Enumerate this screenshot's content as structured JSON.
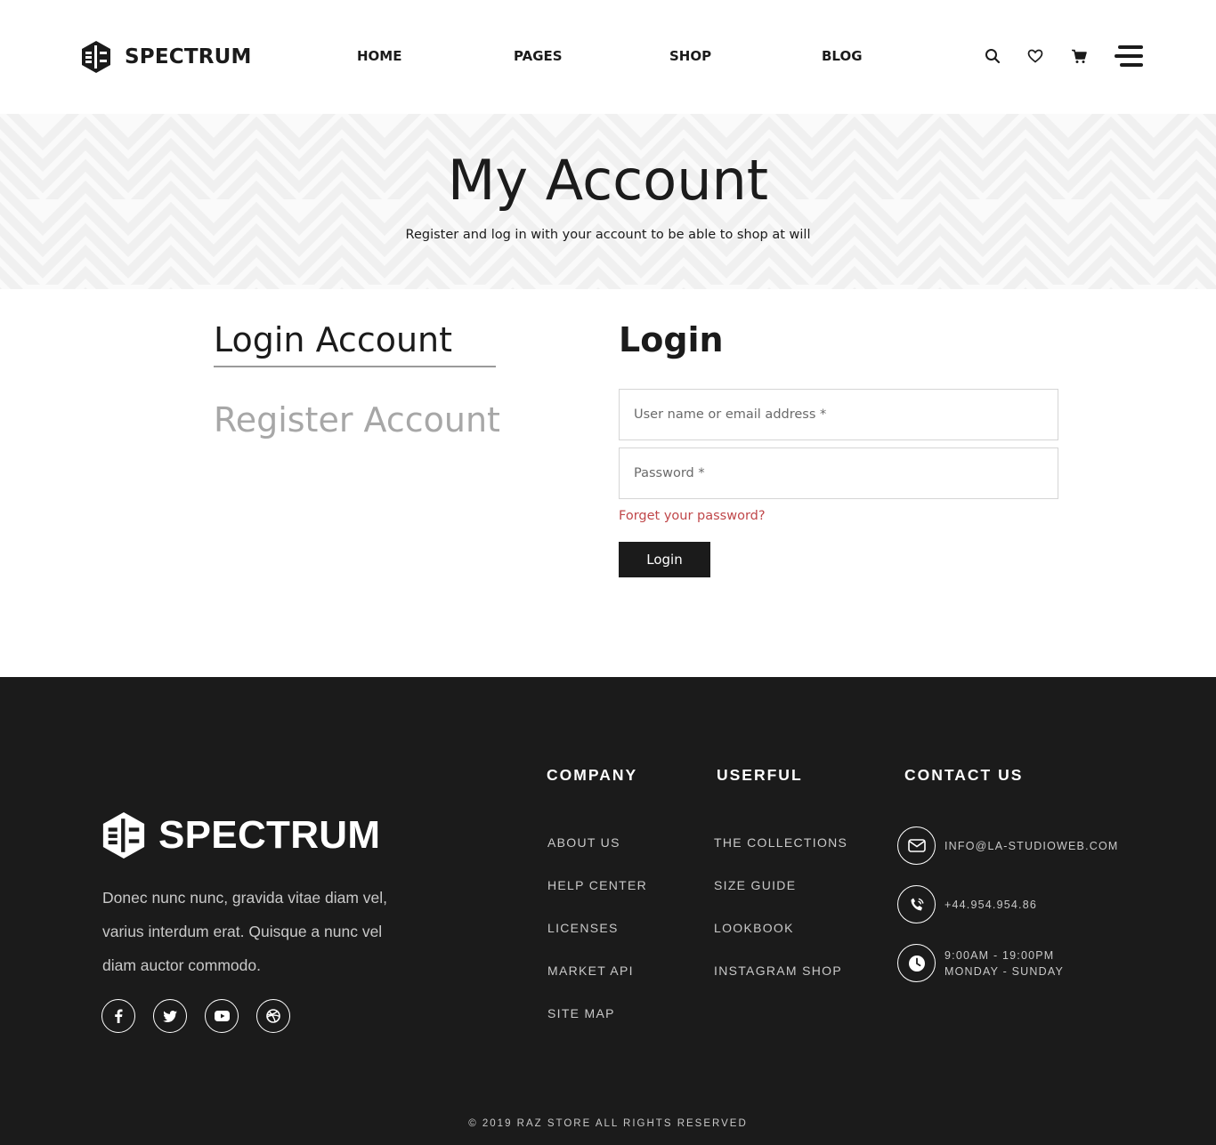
{
  "header": {
    "brand": "SPECTRUM",
    "nav": [
      {
        "label": "HOME"
      },
      {
        "label": "PAGES"
      },
      {
        "label": "SHOP"
      },
      {
        "label": "BLOG"
      }
    ],
    "icons": [
      "search-icon",
      "heart-icon",
      "cart-icon",
      "menu-icon"
    ]
  },
  "banner": {
    "title": "My Account",
    "subtitle": "Register and log in with your account to be able to shop at will"
  },
  "account": {
    "tabs": {
      "login": "Login Account",
      "register": "Register Account"
    },
    "active_tab": "login",
    "form": {
      "title": "Login",
      "username_placeholder": "User name or email address *",
      "username_value": "",
      "password_placeholder": "Password *",
      "password_value": "",
      "forgot_label": "Forget your password?",
      "submit_label": "Login"
    }
  },
  "footer": {
    "brand": "SPECTRUM",
    "description": "Donec nunc nunc, gravida vitae diam vel, varius interdum erat. Quisque a nunc vel diam auctor commodo.",
    "social": [
      "facebook-icon",
      "twitter-icon",
      "youtube-icon",
      "dribbble-icon"
    ],
    "company": {
      "title": "COMPANY",
      "links": [
        "ABOUT US",
        "HELP CENTER",
        "LICENSES",
        "MARKET API",
        "SITE MAP"
      ]
    },
    "useful": {
      "title": "USERFUL",
      "links": [
        "THE COLLECTIONS",
        "SIZE GUIDE",
        "LOOKBOOK",
        "INSTAGRAM SHOP"
      ]
    },
    "contact": {
      "title": "CONTACT US",
      "email": "INFO@LA-STUDIOWEB.COM",
      "phone": "+44.954.954.86",
      "hours": "9:00AM - 19:00PM",
      "days": "MONDAY - SUNDAY"
    },
    "copyright": "© 2019 RAZ STORE ALL RIGHTS RESERVED"
  },
  "colors": {
    "dark": "#1b1b1b",
    "accent_link": "#c0474a",
    "muted_tab": "#a7a7a7",
    "footer_text": "#c9c9c9"
  }
}
